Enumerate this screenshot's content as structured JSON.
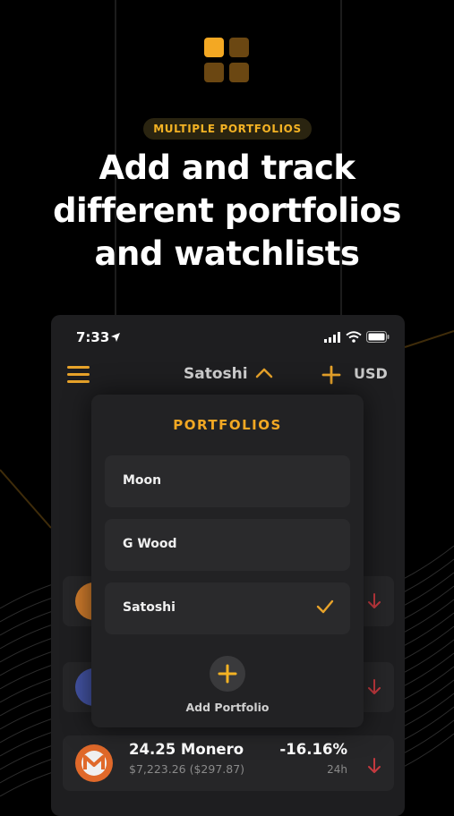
{
  "promo": {
    "badge": "MULTIPLE PORTFOLIOS",
    "headline_line1": "Add and track",
    "headline_line2": "different portfolios",
    "headline_line3": "and watchlists"
  },
  "colors": {
    "accent": "#f3a823",
    "negative": "#c4393f",
    "background": "#000000",
    "card": "#1e1e20"
  },
  "status_bar": {
    "time": "7:33",
    "icons": [
      "location-arrow-icon",
      "signal-icon",
      "wifi-icon",
      "battery-icon"
    ]
  },
  "nav": {
    "menu_icon": "hamburger-menu-icon",
    "portfolio_name": "Satoshi",
    "chevron_icon": "chevron-up-icon",
    "add_icon": "plus-icon",
    "currency": "USD"
  },
  "assets": [
    {
      "name": "",
      "icon": "coin-icon",
      "color": "#d07c2c",
      "trend": "down"
    },
    {
      "name": "",
      "icon": "coin-icon",
      "color": "#4353a3",
      "trend": "down"
    },
    {
      "name": "24.25 Monero",
      "value": "$7,223.26 ($297.87)",
      "change": "-16.16%",
      "period": "24h",
      "icon": "monero-icon",
      "color": "#e0692a",
      "trend": "down"
    }
  ],
  "dropdown": {
    "title": "PORTFOLIOS",
    "items": [
      {
        "label": "Moon",
        "selected": false
      },
      {
        "label": "G Wood",
        "selected": false
      },
      {
        "label": "Satoshi",
        "selected": true
      }
    ],
    "add_label": "Add Portfolio"
  }
}
